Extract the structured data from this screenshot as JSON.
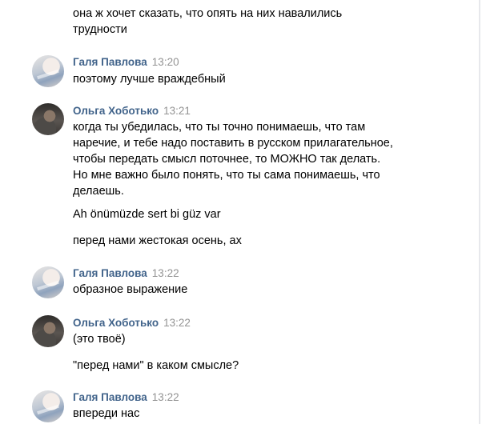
{
  "messages": [
    {
      "lines": [
        "она ж хочет сказать, что опять на них навалились",
        "трудности"
      ]
    },
    {
      "author": "Галя Павлова",
      "time": "13:20",
      "lines": [
        "поэтому лучше враждебный"
      ]
    },
    {
      "author": "Ольга Хоботько",
      "time": "13:21",
      "lines": [
        "когда ты убедилась, что ты точно понимаешь, что там",
        "наречие, и тебе надо поставить в русском прилагательное,",
        "чтобы передать смысл поточнее, то МОЖНО так делать.",
        "Но мне важно было понять, что ты сама понимаешь, что",
        "делаешь."
      ],
      "extra1": "Ah önümüzde sert bi güz var",
      "extra2": "перед нами жестокая осень, ах"
    },
    {
      "author": "Галя Павлова",
      "time": "13:22",
      "lines": [
        "образное выражение"
      ]
    },
    {
      "author": "Ольга Хоботько",
      "time": "13:22",
      "lines": [
        "(это твоё)"
      ],
      "extra1": "\"перед нами\" в каком смысле?"
    },
    {
      "author": "Галя Павлова",
      "time": "13:22",
      "lines": [
        "впереди нас"
      ]
    }
  ]
}
